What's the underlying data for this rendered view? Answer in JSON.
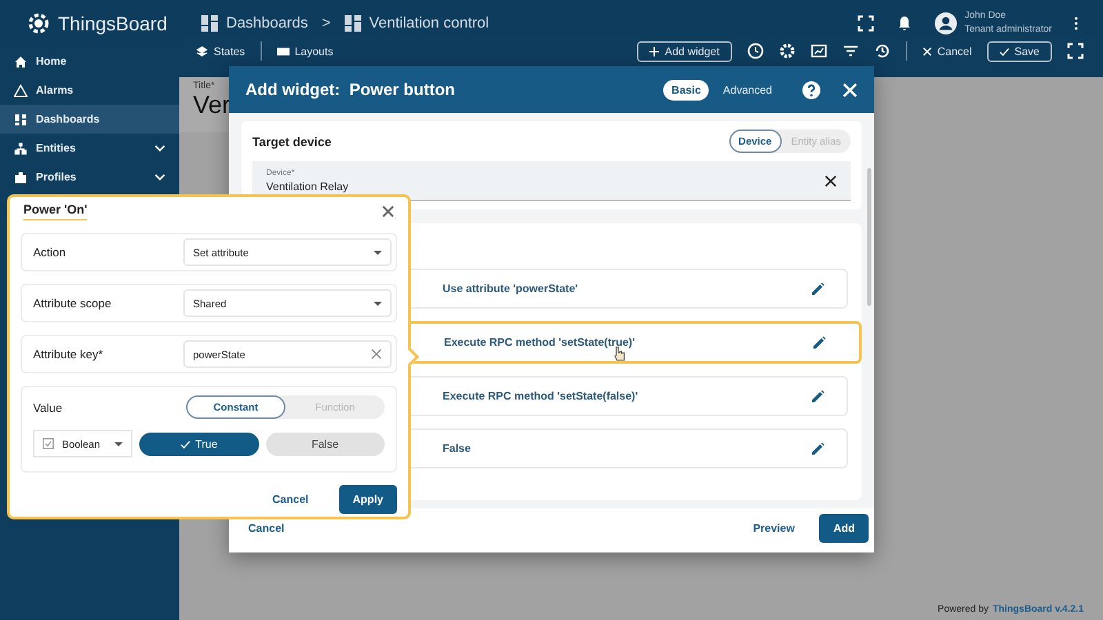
{
  "app": {
    "logo": "ThingsBoard"
  },
  "breadcrumbs": [
    {
      "label": "Dashboards"
    },
    {
      "label": "Ventilation control"
    }
  ],
  "breadcrumb_separator": ">",
  "user": {
    "name": "John Doe",
    "role": "Tenant administrator"
  },
  "sidebar": {
    "items": [
      {
        "label": "Home",
        "selected": false
      },
      {
        "label": "Alarms",
        "selected": false
      },
      {
        "label": "Dashboards",
        "selected": true
      },
      {
        "label": "Entities",
        "selected": false,
        "expanded": false
      },
      {
        "label": "Profiles",
        "selected": false,
        "expanded": false
      }
    ]
  },
  "toolbar": {
    "tabs": [
      "States",
      "Layouts"
    ],
    "add_widget": "Add widget",
    "cancel": "Cancel",
    "save": "Save"
  },
  "canvas": {
    "title_label": "Title*",
    "title_value": "Ver"
  },
  "dialog": {
    "title": "Add widget:  Power button",
    "modes": [
      {
        "label": "Basic",
        "selected": true
      },
      {
        "label": "Advanced",
        "selected": false
      }
    ],
    "target": {
      "heading": "Target device",
      "sources": [
        {
          "label": "Device",
          "selected": true
        },
        {
          "label": "Entity alias",
          "selected": false
        }
      ],
      "device_label": "Device*",
      "device_value": "Ventilation Relay"
    },
    "behaviors": [
      {
        "label": "Use attribute 'powerState'",
        "highlighted": false
      },
      {
        "label": "Execute RPC method 'setState(true)'",
        "highlighted": true
      },
      {
        "label": "Execute RPC method 'setState(false)'",
        "highlighted": false
      },
      {
        "label": "False",
        "highlighted": false
      }
    ],
    "cancel": "Cancel",
    "preview": "Preview",
    "add": "Add"
  },
  "popup": {
    "title": "Power 'On'",
    "fields": [
      {
        "kind": "select",
        "label": "Action",
        "value": "Set attribute"
      },
      {
        "kind": "select",
        "label": "Attribute scope",
        "value": "Shared"
      },
      {
        "kind": "input",
        "label": "Attribute key*",
        "value": "powerState"
      }
    ],
    "value": {
      "label": "Value",
      "modes": [
        {
          "label": "Constant",
          "selected": true
        },
        {
          "label": "Function",
          "selected": false
        }
      ],
      "type": "Boolean",
      "options": [
        {
          "label": "True",
          "selected": true
        },
        {
          "label": "False",
          "selected": false
        }
      ]
    },
    "cancel": "Cancel",
    "apply": "Apply"
  },
  "footer": {
    "prefix": "Powered by",
    "brand": "ThingsBoard v.4.2.1"
  }
}
